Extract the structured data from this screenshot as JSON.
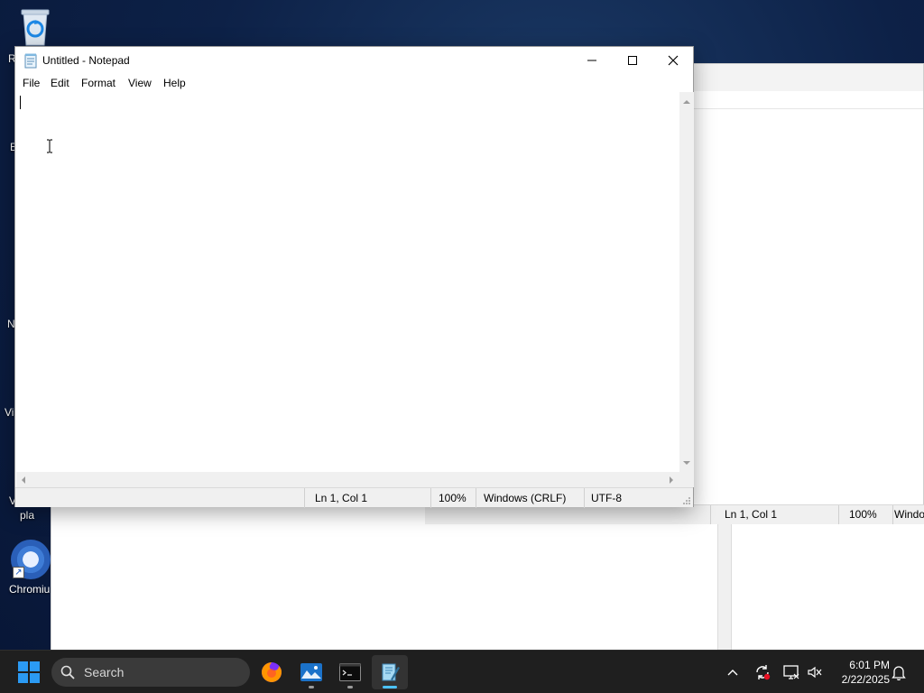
{
  "desktop": {
    "icons": [
      {
        "name": "Recycle Bin",
        "label_visible": "R"
      },
      {
        "name": "partial-E",
        "label_visible": "E"
      },
      {
        "name": "partial-N",
        "label_visible": "N"
      },
      {
        "name": "partial-Vis",
        "label_visible": "Vis"
      },
      {
        "name": "partial-pla",
        "label_visible_top": "V",
        "label_visible": "pla"
      },
      {
        "name": "Chromium",
        "label_visible": "Chromiu"
      }
    ]
  },
  "background_window": {
    "status": {
      "position": "Ln 1, Col 1",
      "zoom": "100%",
      "line_ending": "Windo"
    }
  },
  "notepad": {
    "title": "Untitled - Notepad",
    "menu": [
      "File",
      "Edit",
      "Format",
      "View",
      "Help"
    ],
    "content": "",
    "status": {
      "position": "Ln 1, Col 1",
      "zoom": "100%",
      "line_ending": "Windows (CRLF)",
      "encoding": "UTF-8"
    },
    "controls": {
      "minimize": "minimize-icon",
      "maximize": "maximize-icon",
      "close": "close-icon"
    }
  },
  "taskbar": {
    "search_placeholder": "Search",
    "apps": [
      {
        "name": "Firefox",
        "icon": "firefox-icon",
        "active": false
      },
      {
        "name": "Photos",
        "icon": "photos-icon",
        "active": false
      },
      {
        "name": "Terminal",
        "icon": "terminal-icon",
        "active": false
      },
      {
        "name": "Notepad",
        "icon": "notepad-icon",
        "active": true
      }
    ],
    "tray": [
      "chevron-up-icon",
      "sync-icon",
      "network-icon",
      "volume-muted-icon"
    ],
    "clock": {
      "time": "6:01 PM",
      "date": "2/22/2025"
    },
    "notification_icon": "bell-icon"
  },
  "colors": {
    "accent": "#2b9af3",
    "active_indicator": "#4cc2ff",
    "taskbar": "#1f1f1f"
  }
}
